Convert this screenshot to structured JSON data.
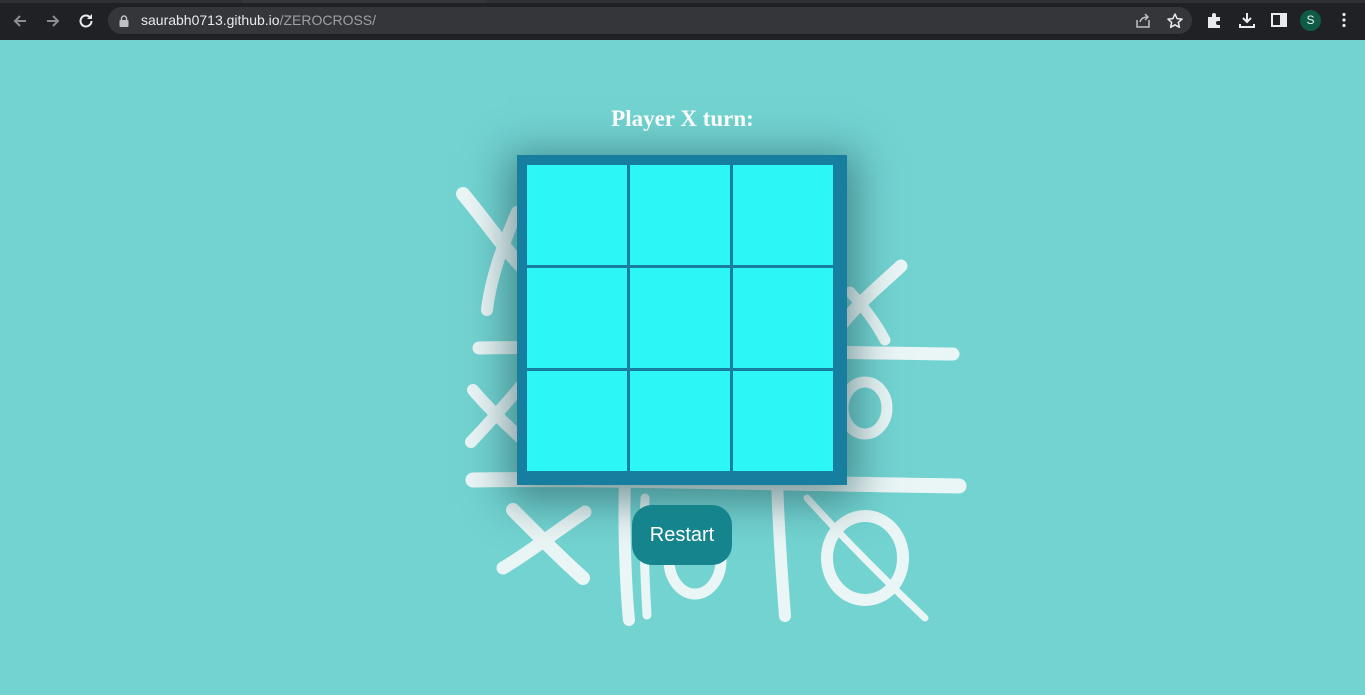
{
  "browser": {
    "url_host": "saurabh0713.github.io",
    "url_path": "/ZEROCROSS/",
    "profile_initial": "S",
    "icons": [
      "back-icon",
      "forward-icon",
      "reload-icon",
      "lock-icon",
      "share-icon",
      "bookmark-star-icon",
      "extensions-icon",
      "download-icon",
      "side-panel-icon",
      "menu-icon"
    ]
  },
  "game": {
    "turn_text": "Player X turn:",
    "cells": [
      "",
      "",
      "",
      "",
      "",
      "",
      "",
      "",
      ""
    ],
    "restart_label": "Restart"
  },
  "colors": {
    "page_background": "#72d3d1",
    "board_border": "#177e9f",
    "cell": "#2cf6f6",
    "restart_button": "#16848d",
    "title_text": "#ffffff"
  }
}
